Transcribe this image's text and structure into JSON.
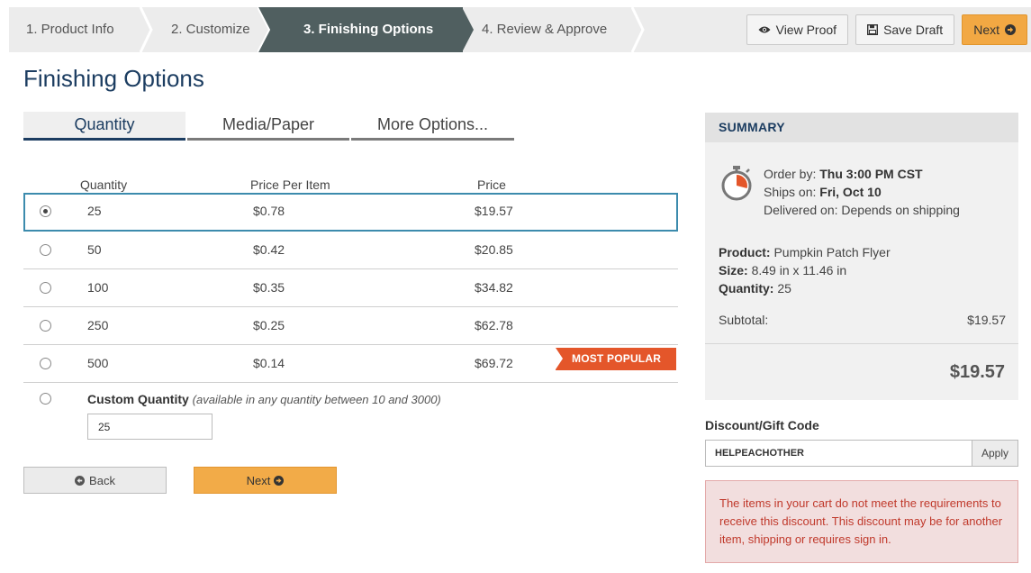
{
  "steps": [
    {
      "label": "1. Product Info"
    },
    {
      "label": "2. Customize"
    },
    {
      "label": "3. Finishing Options"
    },
    {
      "label": "4. Review & Approve"
    }
  ],
  "actions": {
    "view_proof": "View Proof",
    "save_draft": "Save Draft",
    "next": "Next"
  },
  "page_title": "Finishing Options",
  "tabs": [
    {
      "label": "Quantity",
      "active": true
    },
    {
      "label": "Media/Paper"
    },
    {
      "label": "More Options..."
    }
  ],
  "table": {
    "headers": {
      "quantity": "Quantity",
      "ppi": "Price Per Item",
      "price": "Price"
    },
    "rows": [
      {
        "qty": "25",
        "ppi": "$0.78",
        "price": "$19.57",
        "selected": true
      },
      {
        "qty": "50",
        "ppi": "$0.42",
        "price": "$20.85"
      },
      {
        "qty": "100",
        "ppi": "$0.35",
        "price": "$34.82"
      },
      {
        "qty": "250",
        "ppi": "$0.25",
        "price": "$62.78"
      },
      {
        "qty": "500",
        "ppi": "$0.14",
        "price": "$69.72",
        "badge": "MOST POPULAR"
      }
    ]
  },
  "custom": {
    "label": "Custom Quantity",
    "hint": "(available in any quantity between 10 and 3000)",
    "value": "25"
  },
  "nav": {
    "back": "Back",
    "next": "Next"
  },
  "summary": {
    "title": "SUMMARY",
    "order_by_label": "Order by:",
    "order_by": "Thu 3:00 PM CST",
    "ships_on_label": "Ships on:",
    "ships_on": "Fri, Oct 10",
    "delivered_label": "Delivered on:",
    "delivered": "Depends on shipping",
    "product_label": "Product:",
    "product": "Pumpkin Patch Flyer",
    "size_label": "Size:",
    "size": "8.49 in x 11.46 in",
    "quantity_label": "Quantity:",
    "quantity": "25",
    "subtotal_label": "Subtotal:",
    "subtotal": "$19.57",
    "total": "$19.57"
  },
  "discount": {
    "label": "Discount/Gift Code",
    "code": "HELPEACHOTHER",
    "apply": "Apply",
    "message": "The items in your cart do not meet the requirements to receive this discount. This discount may be for another item, shipping or requires sign in."
  },
  "colors": {
    "accent_navy": "#1c3d61",
    "active_step": "#505f60",
    "orange": "#f2a843",
    "badge": "#e4562a",
    "selected_border": "#3c8bad",
    "alert_bg": "#f2dede"
  },
  "icons": [
    "eye-icon",
    "floppy-disk-icon",
    "arrow-right-circle-icon",
    "arrow-left-circle-icon",
    "stopwatch-icon"
  ]
}
